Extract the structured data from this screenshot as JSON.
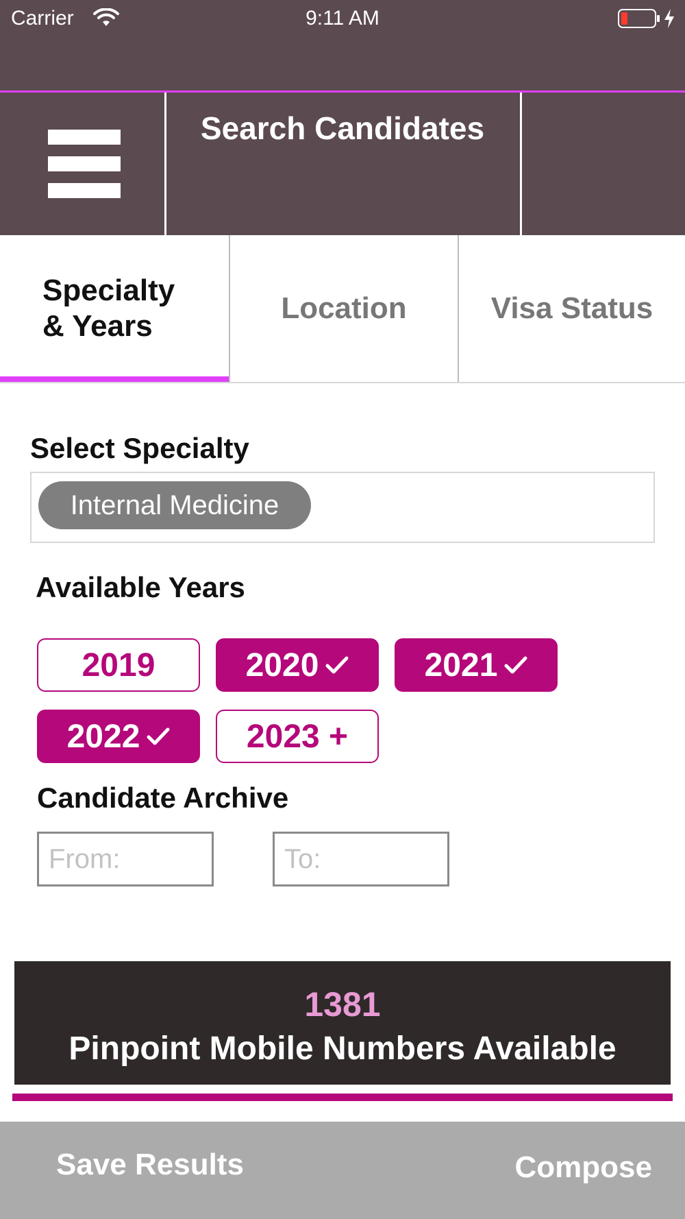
{
  "status_bar": {
    "carrier": "Carrier",
    "time": "9:11 AM",
    "icons": [
      "wifi-icon",
      "battery-low-icon",
      "charging-bolt-icon"
    ]
  },
  "header": {
    "menu_icon": "hamburger-menu-icon",
    "title": "Search Candidates"
  },
  "tabs": [
    {
      "label": "Specialty\n& Years",
      "active": true
    },
    {
      "label": "Location",
      "active": false
    },
    {
      "label": "Visa Status",
      "active": false
    }
  ],
  "specialty": {
    "label": "Select Specialty",
    "selected": "Internal Medicine"
  },
  "years": {
    "label": "Available Years",
    "options": [
      {
        "label": "2019",
        "selected": false
      },
      {
        "label": "2020",
        "selected": true
      },
      {
        "label": "2021",
        "selected": true
      },
      {
        "label": "2022",
        "selected": true
      },
      {
        "label": "2023 +",
        "selected": false
      }
    ]
  },
  "archive": {
    "label": "Candidate Archive",
    "from_placeholder": "From:",
    "to_placeholder": "To:"
  },
  "results": {
    "count": "1381",
    "label": "Pinpoint Mobile Numbers Available"
  },
  "footer": {
    "save_label": "Save Results",
    "compose_label": "Compose"
  },
  "colors": {
    "header_bg": "#5b4a50",
    "accent_pink": "#e040fb",
    "chip_magenta": "#b5087a",
    "count_pink": "#e89ad4",
    "banner_bg": "#2f2929",
    "footer_bg": "#ababab"
  }
}
